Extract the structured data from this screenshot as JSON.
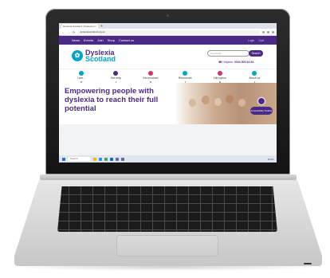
{
  "browser": {
    "tab_title": "Dyslexia Scotland | Dyslexia Ch...",
    "tab_close": "×",
    "new_tab": "+",
    "url": "dyslexiascotland.org.uk",
    "nav_back": "←",
    "nav_forward": "→",
    "nav_reload": "⟳"
  },
  "site": {
    "topnav": [
      "News",
      "Events",
      "Join",
      "Shop",
      "Contact us"
    ],
    "login_label": "Login",
    "cart_label": "Cart",
    "logo_text_line1": "Dyslexia",
    "logo_text_line2": "Scotland",
    "search_placeholder": "Keywords",
    "search_button": "Search",
    "helpline_label": "Helpline:",
    "helpline_number": "0344 800 84 84",
    "menu": [
      {
        "label": "I am...",
        "color": "#00a6c9"
      },
      {
        "label": "Get help",
        "color": "#4b2a86"
      },
      {
        "label": "Get involved",
        "color": "#d6336c"
      },
      {
        "label": "Resources",
        "color": "#00a6c9"
      },
      {
        "label": "Life topics",
        "color": "#d6336c"
      },
      {
        "label": "About us",
        "color": "#00a6c9"
      }
    ],
    "hero_title": "Empowering people with dyslexia to reach their full potential",
    "accessibility_button": "Accessibility Toolbar"
  },
  "taskbar": {
    "search_label": "Search",
    "time": "11:01"
  },
  "colors": {
    "brand_purple": "#4b2a86",
    "brand_teal": "#00a6c9",
    "brand_pink": "#d6336c"
  }
}
